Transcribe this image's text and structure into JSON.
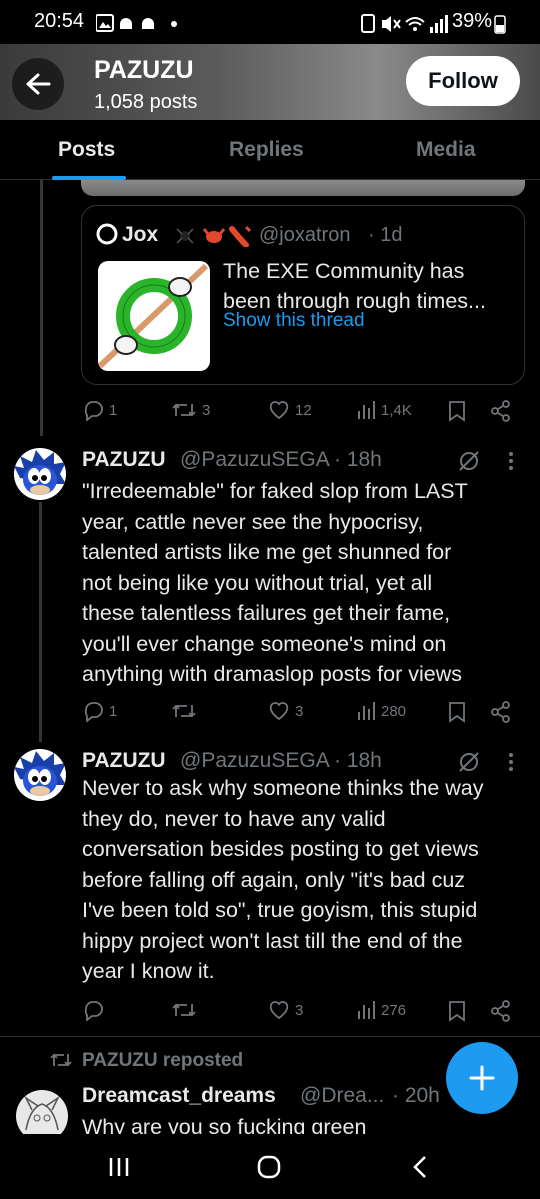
{
  "status_bar": {
    "time": "20:54",
    "battery": "39%"
  },
  "profile": {
    "name": "PAZUZU",
    "post_count": "1,058 posts",
    "follow_label": "Follow"
  },
  "tabs": [
    "Posts",
    "Replies",
    "Media"
  ],
  "quote": {
    "author": "Jox",
    "handle": "@joxatron",
    "time": "· 1d",
    "text_line1": "The EXE Community has",
    "text_line2": "been through rough times...",
    "show_thread": "Show this thread"
  },
  "quote_actions": {
    "replies": "1",
    "reposts": "3",
    "likes": "12",
    "views": "1,4K"
  },
  "tweets": [
    {
      "name": "PAZUZU",
      "handle": "@PazuzuSEGA",
      "time": "· 18h",
      "lines": [
        "\"Irredeemable\" for faked slop from LAST",
        "year, cattle never see the hypocrisy,",
        "talented artists like me get shunned for",
        "not being like you without trial, yet all",
        "these talentless failures get their fame,",
        "you'll ever change someone's mind on",
        "anything with dramaslop posts for views"
      ],
      "replies": "1",
      "reposts": "",
      "likes": "3",
      "views": "280"
    },
    {
      "name": "PAZUZU",
      "handle": "@PazuzuSEGA",
      "time": "· 18h",
      "lines": [
        "Never to ask why someone thinks the way",
        "they do, never to have any valid",
        "conversation besides posting to get views",
        "before falling off again, only \"it's bad cuz",
        "I've been told so\", true goyism, this stupid",
        "hippy project won't last till the end of the",
        "year I know it."
      ],
      "replies": "",
      "reposts": "",
      "likes": "3",
      "views": "276"
    }
  ],
  "repost": {
    "label": "PAZUZU reposted",
    "name": "Dreamcast_dreams",
    "handle": "@Drea...",
    "time": "· 20h",
    "text": "Why are you so fucking green"
  },
  "colors": {
    "accent": "#1d9bf0",
    "muted": "#71767b",
    "divider": "#2f3336",
    "ring": "#2ab42a"
  }
}
